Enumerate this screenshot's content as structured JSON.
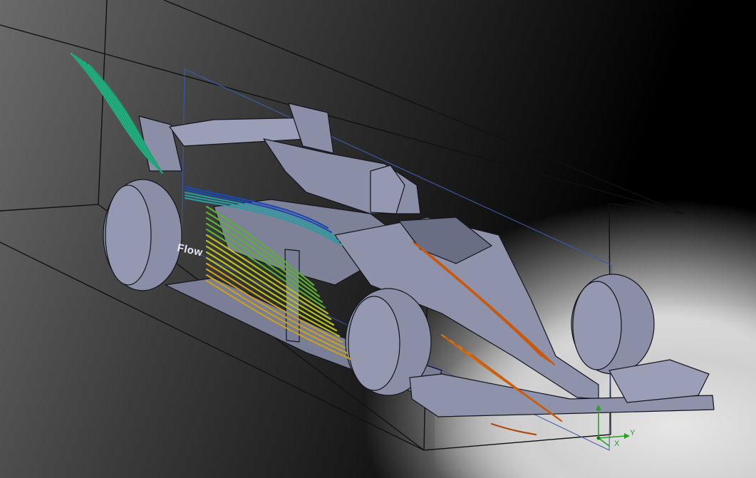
{
  "scene": {
    "subject": "f1-car-cfd-flow-trajectories",
    "sidewall_text": "Flow",
    "triad": {
      "y_label": "Y",
      "x_label": "X"
    }
  },
  "colors": {
    "background_dark": "#000000",
    "background_mid": "#4a4a4a",
    "floor_light": "#e0e0e0",
    "car_body": "#8a8ea6",
    "car_edge": "#1a1a22",
    "domain_box": "#1a1a1a",
    "blue_box": "#3a5aa8",
    "flow_low": "#1aa06a",
    "flow_mid": "#b8c020",
    "flow_high": "#c85a10",
    "triad_green": "#2aa02a"
  },
  "icons": [
    "coordinate-triad-icon"
  ]
}
